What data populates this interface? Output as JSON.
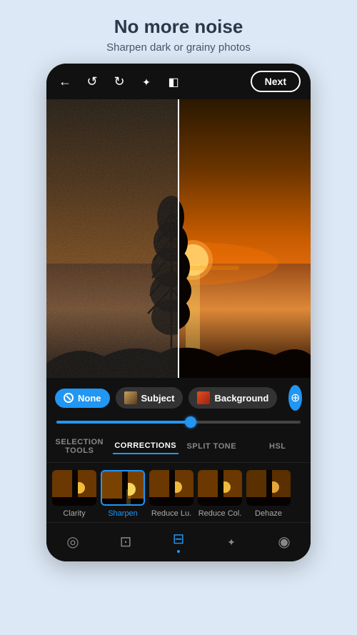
{
  "header": {
    "title": "No more noise",
    "subtitle": "Sharpen dark or grainy photos"
  },
  "topBar": {
    "nextLabel": "Next"
  },
  "maskTools": {
    "noneLabel": "None",
    "subjectLabel": "Subject",
    "backgroundLabel": "Background"
  },
  "tabs": [
    {
      "id": "selection_tools",
      "label": "SELECTION TOOLS",
      "active": false
    },
    {
      "id": "corrections",
      "label": "CORRECTIONS",
      "active": true
    },
    {
      "id": "split_tone",
      "label": "SPLIT TONE",
      "active": false
    },
    {
      "id": "hsl",
      "label": "HSL",
      "active": false
    }
  ],
  "thumbnails": [
    {
      "label": "Clarity",
      "active": false
    },
    {
      "label": "Sharpen",
      "active": true
    },
    {
      "label": "Reduce Lu.",
      "active": false
    },
    {
      "label": "Reduce Col.",
      "active": false
    },
    {
      "label": "Dehaze",
      "active": false
    }
  ],
  "bottomNav": [
    {
      "id": "radial",
      "icon": "radial-icon",
      "active": false
    },
    {
      "id": "crop",
      "icon": "crop-icon",
      "active": false
    },
    {
      "id": "sliders",
      "icon": "sliders-icon",
      "active": true
    },
    {
      "id": "heal",
      "icon": "heal-icon",
      "active": false
    },
    {
      "id": "eye",
      "icon": "eye-icon",
      "active": false
    }
  ],
  "colors": {
    "accent": "#2196f3",
    "bg": "#dce8f5",
    "phoneBg": "#111111"
  }
}
